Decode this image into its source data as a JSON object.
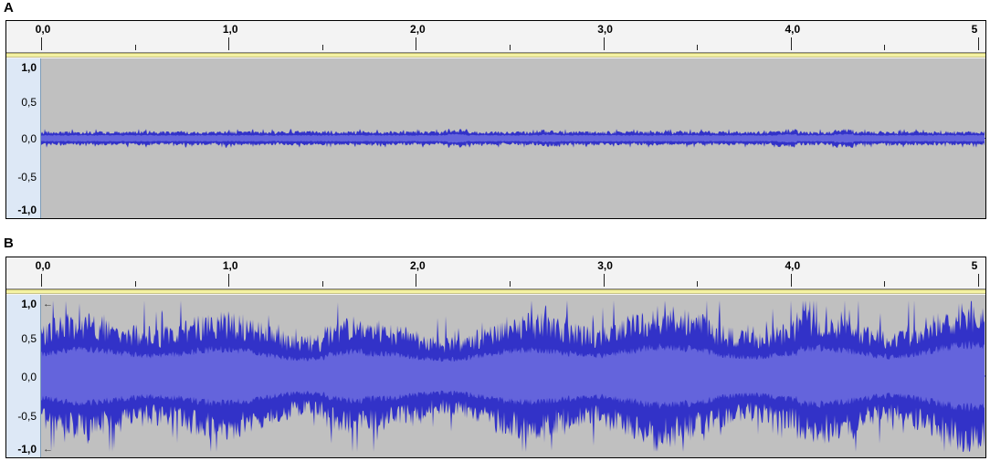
{
  "panels": [
    {
      "label": "A",
      "ruler_ticks": [
        "0,0",
        "1,0",
        "2,0",
        "3,0",
        "4,0",
        "5"
      ],
      "y_labels": [
        "1,0",
        "0,5",
        "0,0",
        "-0,5",
        "-1,0"
      ],
      "arrows": false,
      "amplitude": 0.07,
      "peak": 0.12
    },
    {
      "label": "B",
      "ruler_ticks": [
        "0,0",
        "1,0",
        "2,0",
        "3,0",
        "4,0",
        "5"
      ],
      "y_labels": [
        "1,0",
        "0,5",
        "0,0",
        "-0,5",
        "-1,0"
      ],
      "arrows": true,
      "arrow_glyph": "←",
      "amplitude": 0.55,
      "peak": 0.95
    }
  ],
  "colors": {
    "wave_outer": "#3232c8",
    "wave_inner": "#6464dc",
    "track_bg": "#c0c0c0",
    "axis_bg": "#dde8f6"
  }
}
